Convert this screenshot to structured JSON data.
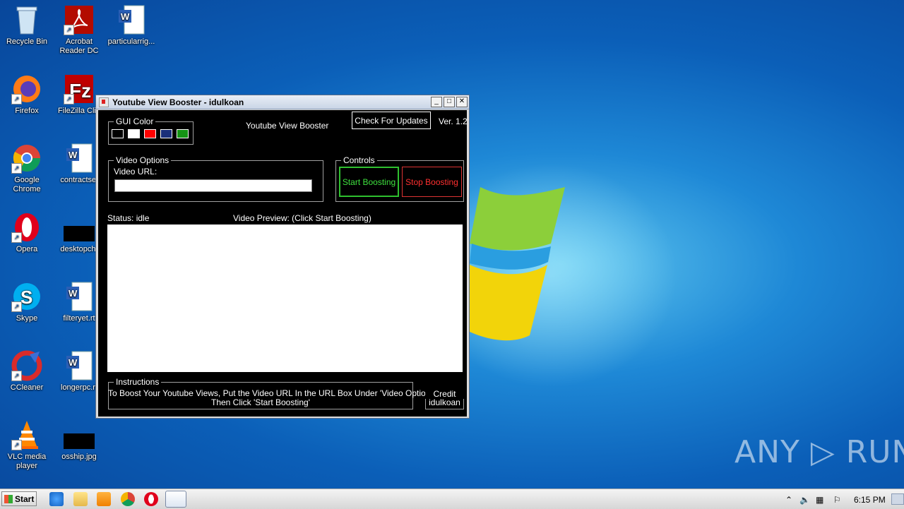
{
  "desktop": {
    "icons": [
      {
        "label": "Recycle Bin"
      },
      {
        "label": "Acrobat\nReader DC"
      },
      {
        "label": "particularrig..."
      },
      {
        "label": "Firefox"
      },
      {
        "label": "FileZilla Clie"
      },
      {
        "label": "Google\nChrome"
      },
      {
        "label": "contractsel"
      },
      {
        "label": "Opera"
      },
      {
        "label": "desktopch."
      },
      {
        "label": "Skype"
      },
      {
        "label": "filteryet.rt"
      },
      {
        "label": "CCleaner"
      },
      {
        "label": "longerpc.rt"
      },
      {
        "label": "VLC media\nplayer"
      },
      {
        "label": "osship.jpg"
      }
    ]
  },
  "window": {
    "title": "Youtube View Booster - idulkoan",
    "min_glyph": "_",
    "max_glyph": "□",
    "close_glyph": "✕",
    "app_name": "Youtube View Booster",
    "version": "Ver. 1.2",
    "check_updates_label": "Check For Updates",
    "gui_color": {
      "legend": "GUI Color",
      "swatches": [
        "#000000",
        "#ffffff",
        "#ff0000",
        "#1a2f7a",
        "#159415"
      ]
    },
    "video_options": {
      "legend": "Video Options",
      "url_label": "Video URL:",
      "url_value": ""
    },
    "controls": {
      "legend": "Controls",
      "start_label": "Start Boosting",
      "stop_label": "Stop Boosting"
    },
    "status": "Status: idle",
    "preview_label": "Video Preview: (Click Start Boosting)",
    "instructions": {
      "legend": "Instructions",
      "line1": "To Boost Your Youtube Views, Put the Video URL In the URL Box Under 'Video Options'",
      "line2": "Then Click 'Start Boosting'"
    },
    "credit": {
      "legend": "Credit",
      "name": "idulkoan"
    }
  },
  "taskbar": {
    "start_label": "Start",
    "clock": "6:15 PM"
  },
  "watermark": "ANY ▷ RUN",
  "colors": {
    "accent_green": "#3ee03e",
    "accent_red": "#ff3030"
  }
}
